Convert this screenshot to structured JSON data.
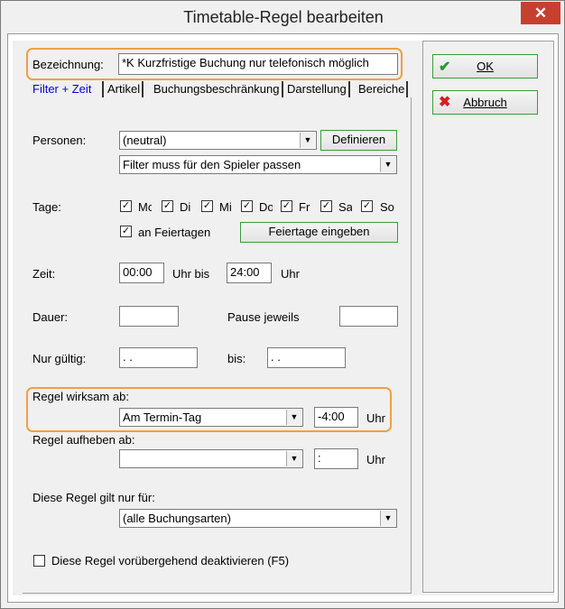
{
  "window": {
    "title": "Timetable-Regel bearbeiten",
    "close_glyph": "✕"
  },
  "name": {
    "label": "Bezeichnung:",
    "value": "*K Kurzfristige Buchung nur telefonisch möglich"
  },
  "tabs": [
    "Filter + Zeit",
    "Artikel",
    "Buchungsbeschränkung",
    "Darstellung",
    "Bereiche"
  ],
  "persons": {
    "label": "Personen:",
    "select_value": "(neutral)",
    "define_button": "Definieren",
    "filter_value": "Filter muss für den Spieler passen"
  },
  "days": {
    "label": "Tage:",
    "items": [
      "Mo",
      "Di",
      "Mi",
      "Do",
      "Fr",
      "Sa",
      "So"
    ],
    "holidays_label": "an Feiertagen",
    "holidays_button": "Feiertage eingeben"
  },
  "time": {
    "label": "Zeit:",
    "from": "00:00",
    "mid_label": "Uhr bis",
    "to": "24:00",
    "unit": "Uhr"
  },
  "duration": {
    "label": "Dauer:",
    "pause_label": "Pause jeweils"
  },
  "valid": {
    "label": "Nur gültig:",
    "from": " .  .",
    "to_label": "bis:",
    "to": " .  ."
  },
  "effective": {
    "label": "Regel wirksam ab:",
    "select_value": "Am Termin-Tag",
    "time": "-4:00",
    "unit": "Uhr"
  },
  "revoke": {
    "label": "Regel aufheben ab:",
    "select_value": "",
    "time": "  :",
    "unit": "Uhr"
  },
  "applies": {
    "label": "Diese Regel gilt nur für:",
    "select_value": "(alle Buchungsarten)"
  },
  "deactivate": {
    "label": "Diese Regel vorübergehend deaktivieren (F5)"
  },
  "buttons": {
    "ok": "OK",
    "cancel": "Abbruch"
  },
  "colors": {
    "highlight": "#f0a040",
    "close_red": "#c7402f",
    "active_tab": "#0000cc"
  }
}
